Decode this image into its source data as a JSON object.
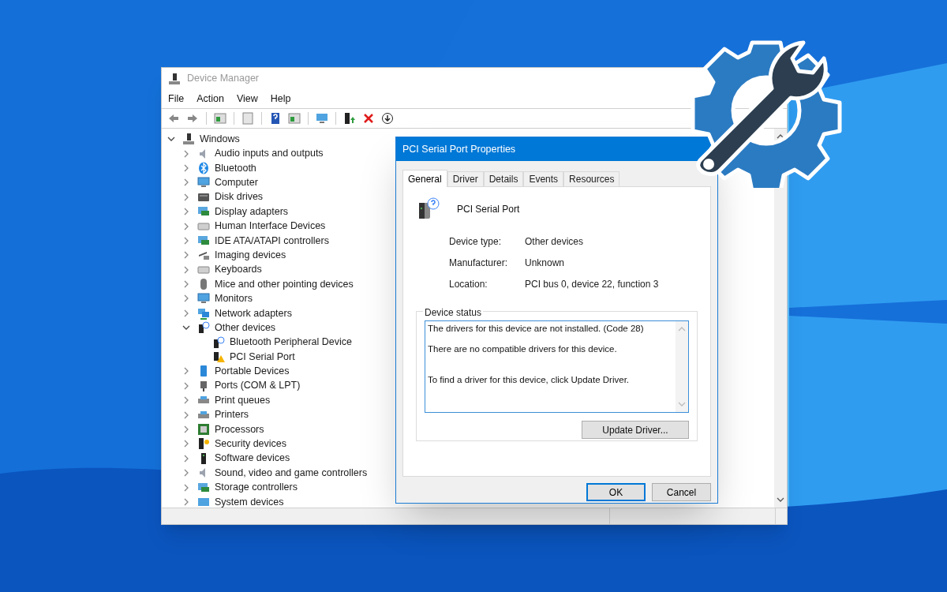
{
  "window": {
    "title": "Device Manager"
  },
  "menu": [
    "File",
    "Action",
    "View",
    "Help"
  ],
  "tree": [
    {
      "label": "Windows",
      "expanded": true,
      "children": [
        {
          "label": "Audio inputs and outputs",
          "expanded": false
        },
        {
          "label": "Bluetooth",
          "expanded": false
        },
        {
          "label": "Computer",
          "expanded": false
        },
        {
          "label": "Disk drives",
          "expanded": false
        },
        {
          "label": "Display adapters",
          "expanded": false
        },
        {
          "label": "Human Interface Devices",
          "expanded": false
        },
        {
          "label": "IDE ATA/ATAPI controllers",
          "expanded": false
        },
        {
          "label": "Imaging devices",
          "expanded": false
        },
        {
          "label": "Keyboards",
          "expanded": false
        },
        {
          "label": "Mice and other pointing devices",
          "expanded": false
        },
        {
          "label": "Monitors",
          "expanded": false
        },
        {
          "label": "Network adapters",
          "expanded": false
        },
        {
          "label": "Other devices",
          "expanded": true,
          "children": [
            {
              "label": "Bluetooth Peripheral Device"
            },
            {
              "label": "PCI Serial Port"
            }
          ]
        },
        {
          "label": "Portable Devices",
          "expanded": false
        },
        {
          "label": "Ports (COM & LPT)",
          "expanded": false
        },
        {
          "label": "Print queues",
          "expanded": false
        },
        {
          "label": "Printers",
          "expanded": false
        },
        {
          "label": "Processors",
          "expanded": false
        },
        {
          "label": "Security devices",
          "expanded": false
        },
        {
          "label": "Software devices",
          "expanded": false
        },
        {
          "label": "Sound, video and game controllers",
          "expanded": false
        },
        {
          "label": "Storage controllers",
          "expanded": false
        },
        {
          "label": "System devices",
          "expanded": false
        }
      ]
    }
  ],
  "dialog": {
    "title": "PCI Serial Port Properties",
    "tabs": [
      {
        "label": "General",
        "selected": true
      },
      {
        "label": "Driver",
        "selected": false
      },
      {
        "label": "Details",
        "selected": false
      },
      {
        "label": "Events",
        "selected": false
      },
      {
        "label": "Resources",
        "selected": false
      }
    ],
    "device_name": "PCI Serial Port",
    "properties": [
      {
        "label": "Device type:",
        "value": "Other devices"
      },
      {
        "label": "Manufacturer:",
        "value": "Unknown"
      },
      {
        "label": "Location:",
        "value": "PCI bus 0, device 22, function 3"
      }
    ],
    "status_group": "Device status",
    "status_text": "The drivers for this device are not installed. (Code 28)\n\nThere are no compatible drivers for this device.\n\n\nTo find a driver for this device, click Update Driver.",
    "update_button": "Update Driver...",
    "buttons": [
      {
        "label": "OK",
        "default": true
      },
      {
        "label": "Cancel",
        "default": false
      }
    ]
  }
}
